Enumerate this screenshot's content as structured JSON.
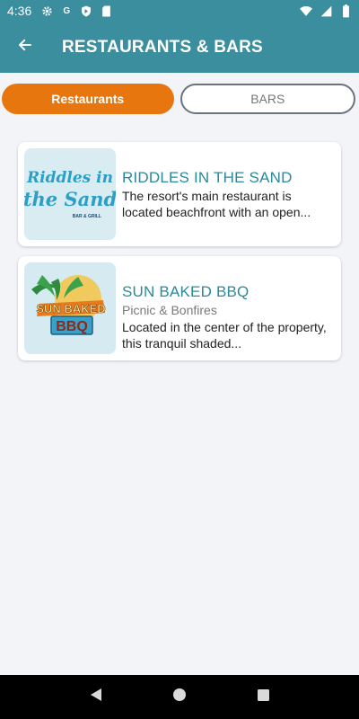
{
  "status_bar": {
    "time": "4:36",
    "left_icons": [
      "gear-icon",
      "ga-icon",
      "shield-icon",
      "sd-card-icon"
    ],
    "right_icons": [
      "wifi-icon",
      "signal-icon",
      "battery-icon"
    ]
  },
  "header": {
    "title": "RESTAURANTS & BARS",
    "back_icon": "arrow-left-icon",
    "background": "#3b8e9e"
  },
  "tabs": [
    {
      "label": "Restaurants",
      "active": true,
      "color": "#e8760e"
    },
    {
      "label": "BARS",
      "active": false
    }
  ],
  "items": [
    {
      "title": "RIDDLES IN THE SAND",
      "subtitle": "",
      "description": "The resort's main restaurant is located beachfront with an open...",
      "logo": {
        "line1": "Riddles in",
        "line2": "the Sand",
        "tag": "BAR & GRILL"
      }
    },
    {
      "title": "SUN BAKED BBQ",
      "subtitle": "Picnic & Bonfires",
      "description": "Located in the center of the property, this tranquil shaded...",
      "logo": {
        "line1": "SUN BAKED",
        "line2": "BBQ"
      }
    }
  ],
  "nav_bar": {
    "buttons": [
      "back-triangle-icon",
      "home-circle-icon",
      "recents-square-icon"
    ]
  }
}
